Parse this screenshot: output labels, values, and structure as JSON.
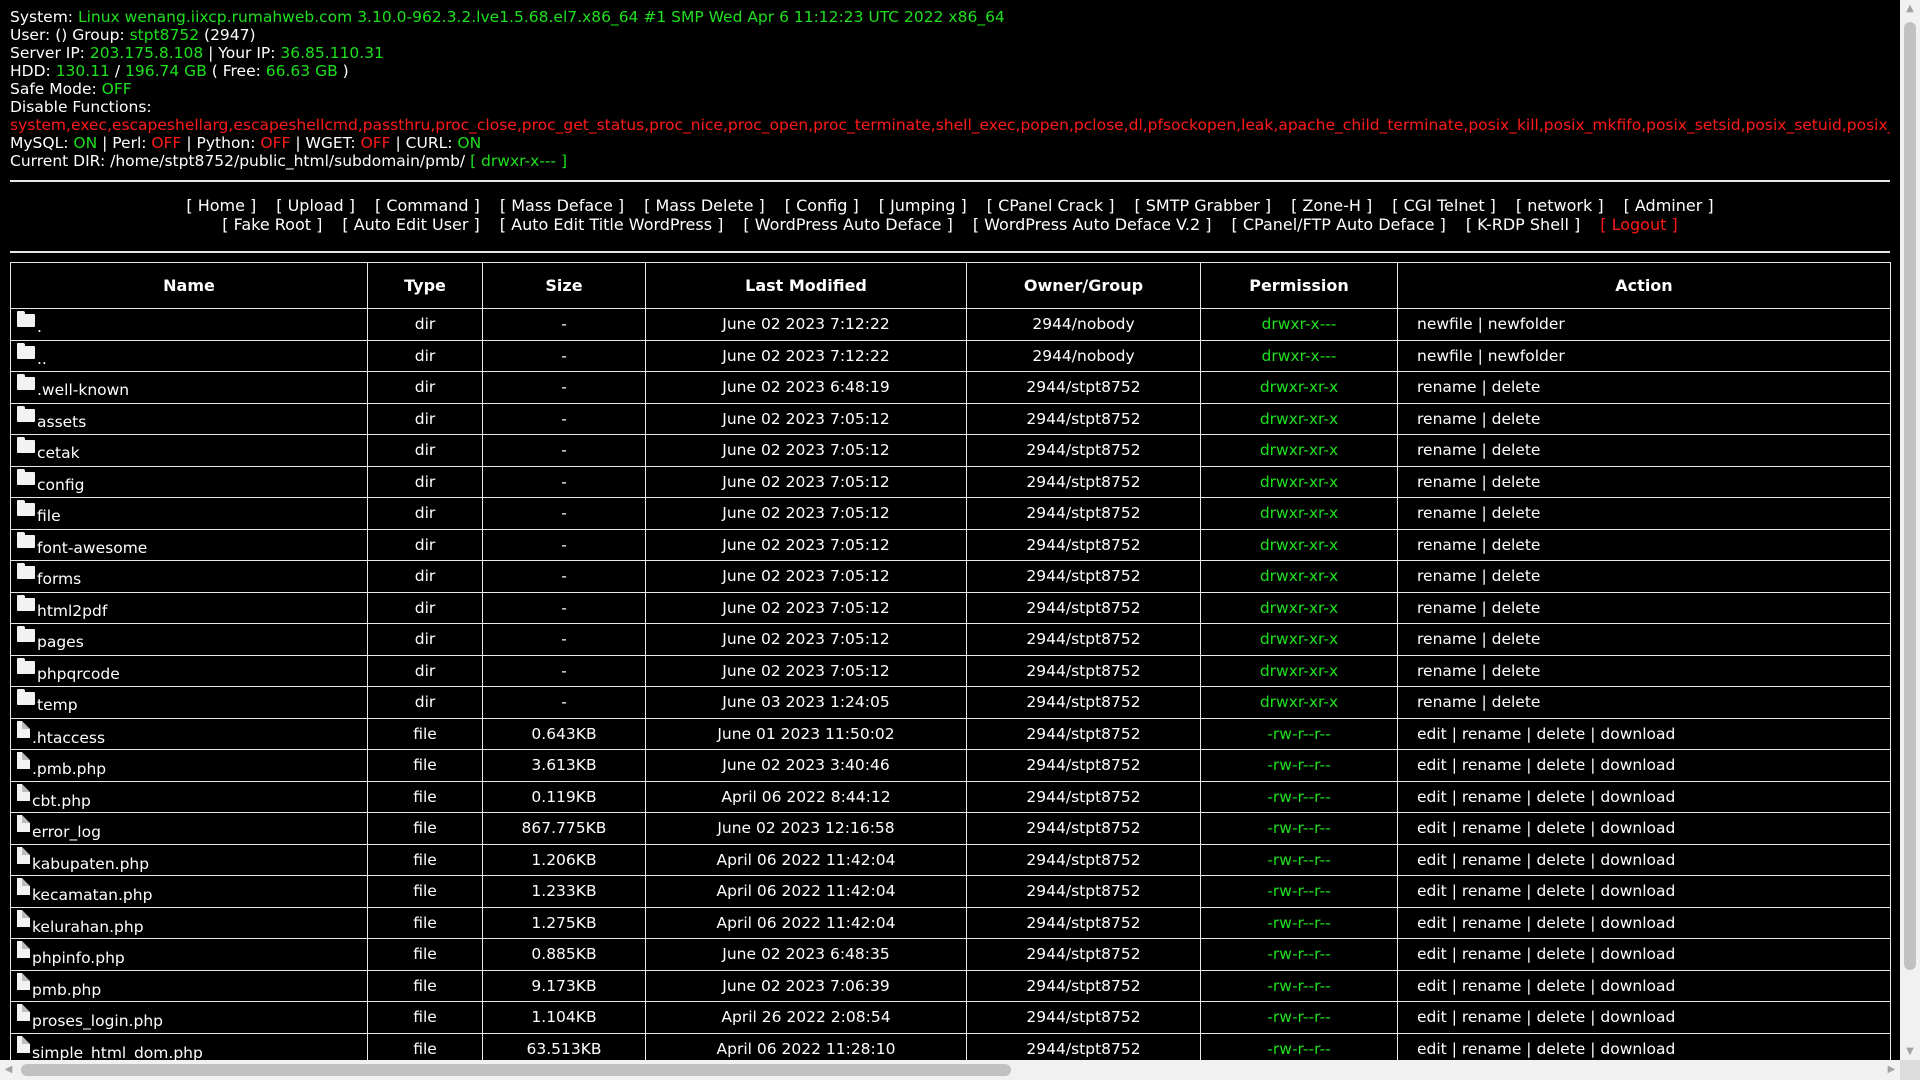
{
  "info": {
    "system_label": "System: ",
    "system_value": "Linux wenang.iixcp.rumahweb.com 3.10.0-962.3.2.lve1.5.68.el7.x86_64 #1 SMP Wed Apr 6 11:12:23 UTC 2022 x86_64",
    "user_label": "User: () Group: ",
    "group_value": "stpt8752",
    "group_id": " (2947)",
    "server_ip_label": "Server IP: ",
    "server_ip": "203.175.8.108",
    "your_ip_label": " | Your IP: ",
    "your_ip": "36.85.110.31",
    "hdd_label": "HDD: ",
    "hdd_used": "130.11",
    "hdd_sep": " / ",
    "hdd_total": "196.74 GB",
    "hdd_free_label": " ( Free: ",
    "hdd_free": "66.63 GB",
    "hdd_close": " )",
    "safe_mode_label": "Safe Mode: ",
    "safe_mode": "OFF",
    "disable_label": "Disable Functions:",
    "disable_value": "system,exec,escapeshellarg,escapeshellcmd,passthru,proc_close,proc_get_status,proc_nice,proc_open,proc_terminate,shell_exec,popen,pclose,dl,pfsockopen,leak,apache_child_terminate,posix_kill,posix_mkfifo,posix_setsid,posix_setuid,posix_setpgid,ini_alter,show_source,define_syslog_variables,symlink",
    "mysql_label": "MySQL: ",
    "mysql": "ON",
    "perl_label": " | Perl: ",
    "perl": "OFF",
    "python_label": " | Python: ",
    "python": "OFF",
    "wget_label": " | WGET: ",
    "wget": "OFF",
    "curl_label": " | CURL: ",
    "curl": "ON",
    "dir_label": "Current DIR: ",
    "dir_value": "/home/stpt8752/public_html/subdomain/pmb/ ",
    "dir_perm": "[ drwxr-x--- ]"
  },
  "nav": {
    "row1": [
      "[ Home ]",
      "[ Upload ]",
      "[ Command ]",
      "[ Mass Deface ]",
      "[ Mass Delete ]",
      "[ Config ]",
      "[ Jumping ]",
      "[ CPanel Crack ]",
      "[ SMTP Grabber ]",
      "[ Zone-H ]",
      "[ CGI Telnet ]",
      "[ network ]",
      "[ Adminer ]"
    ],
    "row2": [
      "[ Fake Root ]",
      "[ Auto Edit User ]",
      "[ Auto Edit Title WordPress ]",
      "[ WordPress Auto Deface ]",
      "[ WordPress Auto Deface V.2 ]",
      "[ CPanel/FTP Auto Deface ]",
      "[ K-RDP Shell ]"
    ],
    "logout": "[ Logout ]"
  },
  "table": {
    "headers": [
      "Name",
      "Type",
      "Size",
      "Last Modified",
      "Owner/Group",
      "Permission",
      "Action"
    ],
    "rows": [
      {
        "name": ".",
        "icon": "folder-icon",
        "type": "dir",
        "size": "-",
        "modified": "June 02 2023 7:12:22",
        "owner": "2944/nobody",
        "perm": "drwxr-x---",
        "actions": [
          "newfile",
          "newfolder"
        ]
      },
      {
        "name": "..",
        "icon": "folder-icon",
        "type": "dir",
        "size": "-",
        "modified": "June 02 2023 7:12:22",
        "owner": "2944/nobody",
        "perm": "drwxr-x---",
        "actions": [
          "newfile",
          "newfolder"
        ]
      },
      {
        "name": ".well-known",
        "icon": "folder-icon",
        "type": "dir",
        "size": "-",
        "modified": "June 02 2023 6:48:19",
        "owner": "2944/stpt8752",
        "perm": "drwxr-xr-x",
        "actions": [
          "rename",
          "delete"
        ]
      },
      {
        "name": "assets",
        "icon": "folder-icon",
        "type": "dir",
        "size": "-",
        "modified": "June 02 2023 7:05:12",
        "owner": "2944/stpt8752",
        "perm": "drwxr-xr-x",
        "actions": [
          "rename",
          "delete"
        ]
      },
      {
        "name": "cetak",
        "icon": "folder-icon",
        "type": "dir",
        "size": "-",
        "modified": "June 02 2023 7:05:12",
        "owner": "2944/stpt8752",
        "perm": "drwxr-xr-x",
        "actions": [
          "rename",
          "delete"
        ]
      },
      {
        "name": "config",
        "icon": "folder-icon",
        "type": "dir",
        "size": "-",
        "modified": "June 02 2023 7:05:12",
        "owner": "2944/stpt8752",
        "perm": "drwxr-xr-x",
        "actions": [
          "rename",
          "delete"
        ]
      },
      {
        "name": "file",
        "icon": "folder-icon",
        "type": "dir",
        "size": "-",
        "modified": "June 02 2023 7:05:12",
        "owner": "2944/stpt8752",
        "perm": "drwxr-xr-x",
        "actions": [
          "rename",
          "delete"
        ]
      },
      {
        "name": "font-awesome",
        "icon": "folder-icon",
        "type": "dir",
        "size": "-",
        "modified": "June 02 2023 7:05:12",
        "owner": "2944/stpt8752",
        "perm": "drwxr-xr-x",
        "actions": [
          "rename",
          "delete"
        ]
      },
      {
        "name": "forms",
        "icon": "folder-icon",
        "type": "dir",
        "size": "-",
        "modified": "June 02 2023 7:05:12",
        "owner": "2944/stpt8752",
        "perm": "drwxr-xr-x",
        "actions": [
          "rename",
          "delete"
        ]
      },
      {
        "name": "html2pdf",
        "icon": "folder-icon",
        "type": "dir",
        "size": "-",
        "modified": "June 02 2023 7:05:12",
        "owner": "2944/stpt8752",
        "perm": "drwxr-xr-x",
        "actions": [
          "rename",
          "delete"
        ]
      },
      {
        "name": "pages",
        "icon": "folder-icon",
        "type": "dir",
        "size": "-",
        "modified": "June 02 2023 7:05:12",
        "owner": "2944/stpt8752",
        "perm": "drwxr-xr-x",
        "actions": [
          "rename",
          "delete"
        ]
      },
      {
        "name": "phpqrcode",
        "icon": "folder-icon",
        "type": "dir",
        "size": "-",
        "modified": "June 02 2023 7:05:12",
        "owner": "2944/stpt8752",
        "perm": "drwxr-xr-x",
        "actions": [
          "rename",
          "delete"
        ]
      },
      {
        "name": "temp",
        "icon": "folder-icon",
        "type": "dir",
        "size": "-",
        "modified": "June 03 2023 1:24:05",
        "owner": "2944/stpt8752",
        "perm": "drwxr-xr-x",
        "actions": [
          "rename",
          "delete"
        ]
      },
      {
        "name": ".htaccess",
        "icon": "file-icon",
        "type": "file",
        "size": "0.643KB",
        "modified": "June 01 2023 11:50:02",
        "owner": "2944/stpt8752",
        "perm": "-rw-r--r--",
        "actions": [
          "edit",
          "rename",
          "delete",
          "download"
        ]
      },
      {
        "name": ".pmb.php",
        "icon": "file-icon",
        "type": "file",
        "size": "3.613KB",
        "modified": "June 02 2023 3:40:46",
        "owner": "2944/stpt8752",
        "perm": "-rw-r--r--",
        "actions": [
          "edit",
          "rename",
          "delete",
          "download"
        ]
      },
      {
        "name": "cbt.php",
        "icon": "file-icon",
        "type": "file",
        "size": "0.119KB",
        "modified": "April 06 2022 8:44:12",
        "owner": "2944/stpt8752",
        "perm": "-rw-r--r--",
        "actions": [
          "edit",
          "rename",
          "delete",
          "download"
        ]
      },
      {
        "name": "error_log",
        "icon": "file-icon",
        "type": "file",
        "size": "867.775KB",
        "modified": "June 02 2023 12:16:58",
        "owner": "2944/stpt8752",
        "perm": "-rw-r--r--",
        "actions": [
          "edit",
          "rename",
          "delete",
          "download"
        ]
      },
      {
        "name": "kabupaten.php",
        "icon": "file-icon",
        "type": "file",
        "size": "1.206KB",
        "modified": "April 06 2022 11:42:04",
        "owner": "2944/stpt8752",
        "perm": "-rw-r--r--",
        "actions": [
          "edit",
          "rename",
          "delete",
          "download"
        ]
      },
      {
        "name": "kecamatan.php",
        "icon": "file-icon",
        "type": "file",
        "size": "1.233KB",
        "modified": "April 06 2022 11:42:04",
        "owner": "2944/stpt8752",
        "perm": "-rw-r--r--",
        "actions": [
          "edit",
          "rename",
          "delete",
          "download"
        ]
      },
      {
        "name": "kelurahan.php",
        "icon": "file-icon",
        "type": "file",
        "size": "1.275KB",
        "modified": "April 06 2022 11:42:04",
        "owner": "2944/stpt8752",
        "perm": "-rw-r--r--",
        "actions": [
          "edit",
          "rename",
          "delete",
          "download"
        ]
      },
      {
        "name": "phpinfo.php",
        "icon": "file-icon",
        "type": "file",
        "size": "0.885KB",
        "modified": "June 02 2023 6:48:35",
        "owner": "2944/stpt8752",
        "perm": "-rw-r--r--",
        "actions": [
          "edit",
          "rename",
          "delete",
          "download"
        ]
      },
      {
        "name": "pmb.php",
        "icon": "file-icon",
        "type": "file",
        "size": "9.173KB",
        "modified": "June 02 2023 7:06:39",
        "owner": "2944/stpt8752",
        "perm": "-rw-r--r--",
        "actions": [
          "edit",
          "rename",
          "delete",
          "download"
        ]
      },
      {
        "name": "proses_login.php",
        "icon": "file-icon",
        "type": "file",
        "size": "1.104KB",
        "modified": "April 26 2022 2:08:54",
        "owner": "2944/stpt8752",
        "perm": "-rw-r--r--",
        "actions": [
          "edit",
          "rename",
          "delete",
          "download"
        ]
      },
      {
        "name": "simple_html_dom.php",
        "icon": "file-icon",
        "type": "file",
        "size": "63.513KB",
        "modified": "April 06 2022 11:28:10",
        "owner": "2944/stpt8752",
        "perm": "-rw-r--r--",
        "actions": [
          "edit",
          "rename",
          "delete",
          "download"
        ]
      }
    ]
  },
  "colors": {
    "background": "#000000",
    "text": "#ffffff",
    "on_green": "#1ee01e",
    "off_red": "#ff1a1a",
    "border": "#e8e8e8"
  }
}
